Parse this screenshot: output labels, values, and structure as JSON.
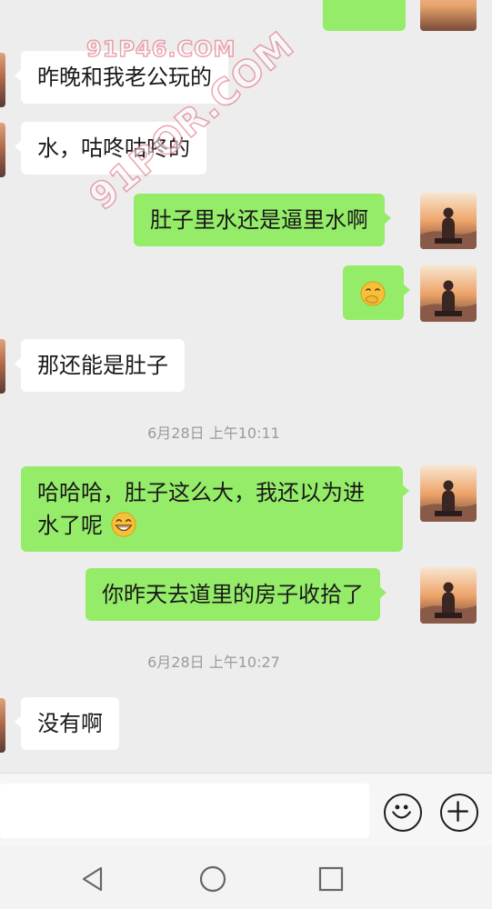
{
  "watermark": {
    "top": "91P46.COM",
    "diagonal": "91POR.COM"
  },
  "messages": [
    {
      "side": "in",
      "text": "昨晚和我老公玩的"
    },
    {
      "side": "in",
      "text": "水，咕咚咕咚的"
    },
    {
      "side": "out",
      "text": "肚子里水还是逼里水啊"
    },
    {
      "side": "out",
      "emoji": "hand-over-mouth-emoji"
    },
    {
      "side": "in",
      "text": "那还能是肚子"
    },
    {
      "timestamp": "6月28日 上午10:11"
    },
    {
      "side": "out",
      "text_line1": "哈哈哈，肚子这么大，我还以为进",
      "text_line2": "水了呢",
      "emoji": "grinning-emoji"
    },
    {
      "side": "out",
      "text": "你昨天去道里的房子收拾了"
    },
    {
      "timestamp": "6月28日 上午10:27"
    },
    {
      "side": "in",
      "text": "没有啊"
    }
  ],
  "colors": {
    "out_bubble": "#95ec69",
    "in_bubble": "#ffffff",
    "background": "#ededed"
  },
  "inputbar": {
    "emoji_button": "smiley-icon",
    "plus_button": "plus-icon"
  },
  "navbar": {
    "back": "back-triangle-icon",
    "home": "home-circle-icon",
    "recents": "recents-square-icon"
  }
}
